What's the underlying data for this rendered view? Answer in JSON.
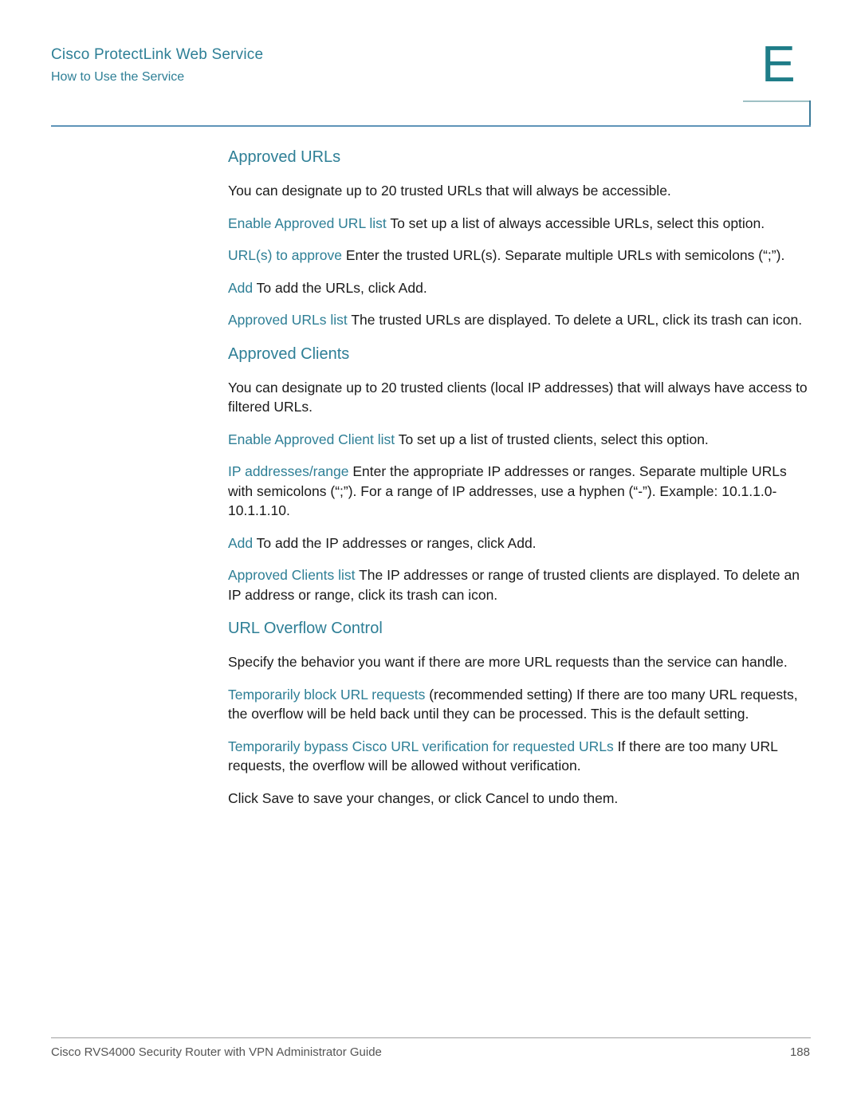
{
  "header": {
    "chapter_title": "Cisco ProtectLink Web Service",
    "section_title": "How to Use the Service",
    "chapter_letter": "E"
  },
  "sections": [
    {
      "heading": "Approved URLs",
      "intro": "You can designate up to 20 trusted URLs that will always be accessible.",
      "items": [
        {
          "term": "Enable Approved URL list",
          "text": " To set up a list of always accessible URLs, select this option."
        },
        {
          "term": "URL(s) to approve",
          "text": " Enter the trusted URL(s). Separate multiple URLs with semicolons (“;”)."
        },
        {
          "term": "Add",
          "text": " To add the URLs, click Add."
        },
        {
          "term": "Approved URLs list",
          "text": " The trusted URLs are displayed. To delete a URL, click its trash can icon."
        }
      ]
    },
    {
      "heading": "Approved Clients",
      "intro": "You can designate up to 20 trusted clients (local IP addresses) that will always have access to filtered URLs.",
      "items": [
        {
          "term": "Enable Approved Client list",
          "text": " To set up a list of trusted clients, select this option."
        },
        {
          "term": "IP addresses/range",
          "text": " Enter the appropriate IP addresses or ranges. Separate multiple URLs with semicolons (“;”). For a range of IP addresses, use a hyphen (“-”). Example: 10.1.1.0-10.1.1.10."
        },
        {
          "term": "Add",
          "text": " To add the IP addresses or ranges, click Add."
        },
        {
          "term": "Approved Clients list",
          "text": " The IP addresses or range of trusted clients are displayed. To delete an IP address or range, click its trash can icon."
        }
      ]
    },
    {
      "heading": "URL Overflow Control",
      "intro": "Specify the behavior you want if there are more URL requests than the service can handle.",
      "items": [
        {
          "term": "Temporarily block URL requests",
          "text": " (recommended setting) If there are too many URL requests, the overflow will be held back until they can be processed. This is the default setting."
        },
        {
          "term": "Temporarily bypass Cisco URL verification for requested URLs",
          "text": " If there are too many URL requests, the overflow will be allowed without verification."
        }
      ],
      "closing": "Click Save to save your changes, or click Cancel to undo them."
    }
  ],
  "footer": {
    "guide_title": "Cisco RVS4000 Security Router with VPN Administrator Guide",
    "page_number": "188"
  }
}
